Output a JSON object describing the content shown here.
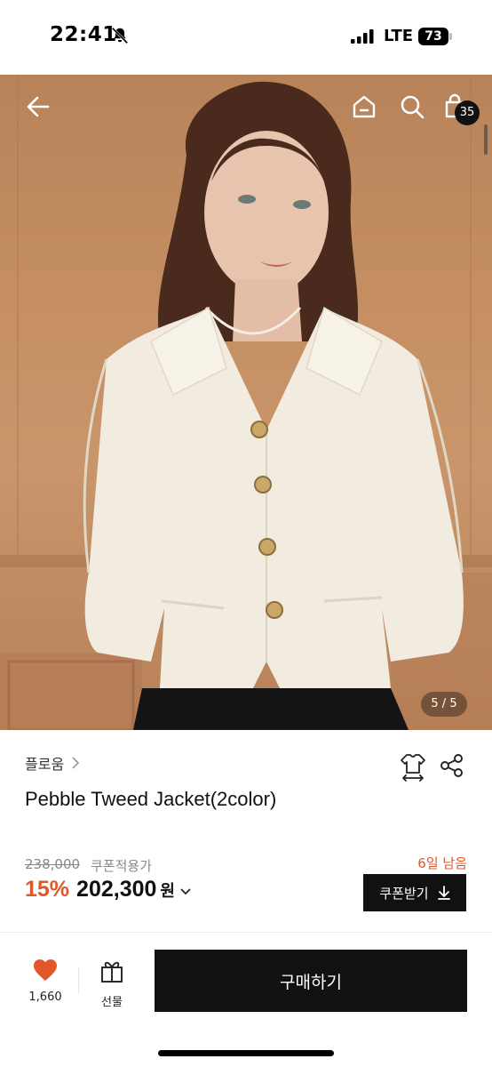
{
  "status_bar": {
    "time": "22:41",
    "network": "LTE",
    "battery": "73",
    "icons": [
      "bell-slash-icon",
      "signal-icon",
      "battery-icon"
    ]
  },
  "hero": {
    "image_counter": "5 / 5",
    "cart_count": "35",
    "icons": [
      "back-arrow-icon",
      "home-icon",
      "search-icon",
      "shopping-bag-icon"
    ]
  },
  "product": {
    "brand": "플로움",
    "title": "Pebble Tweed Jacket(2color)",
    "original_price": "238,000",
    "coupon_note": "쿠폰적용가",
    "days_left": "6일 남음",
    "discount": "15%",
    "sale_price": "202,300",
    "currency": "원",
    "coupon_button": "쿠폰받기",
    "icons": [
      "size-guide-icon",
      "share-icon",
      "download-icon",
      "chevron-right-icon",
      "chevron-down-icon"
    ]
  },
  "bottom_bar": {
    "like_count": "1,660",
    "gift_label": "선물",
    "buy_label": "구매하기",
    "icons": [
      "heart-icon",
      "gift-icon"
    ]
  },
  "colors": {
    "accent": "#e2572a",
    "button_bg": "#111111",
    "heart": "#e2572a"
  }
}
